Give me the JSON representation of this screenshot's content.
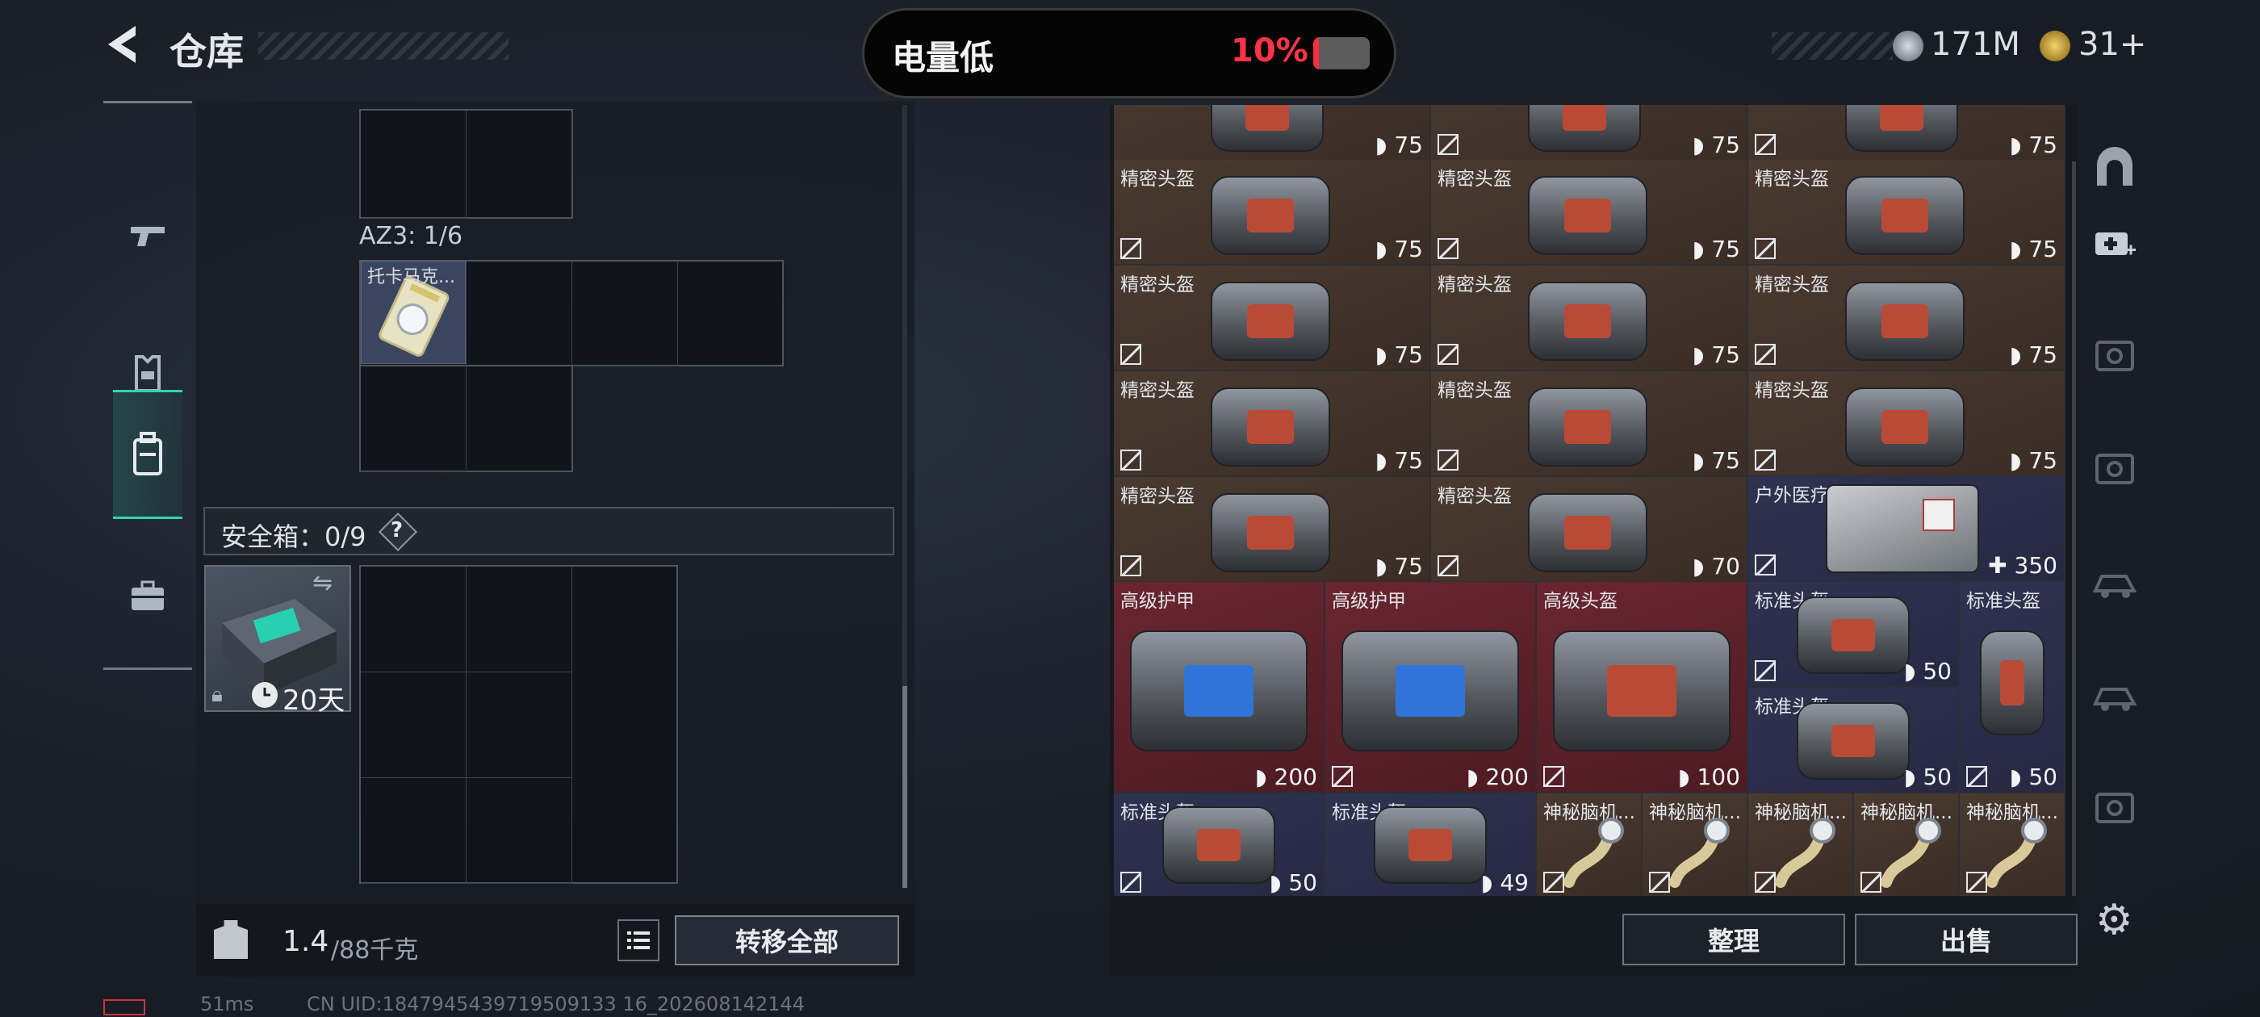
{
  "header": {
    "title": "仓库",
    "battery_text": "电量低",
    "battery_percent": "10%",
    "battery_level": 0.1,
    "currency_a": "171M",
    "currency_b": "31+"
  },
  "left_rail": {
    "items": [
      {
        "name": "weapon",
        "icon": "pistol-icon"
      },
      {
        "name": "armor",
        "icon": "vest-icon"
      },
      {
        "name": "backpack",
        "icon": "backpack-icon",
        "active": true
      },
      {
        "name": "case",
        "icon": "briefcase-icon"
      }
    ]
  },
  "container": {
    "az3_label": "AZ3: 1/6",
    "toka_label": "托卡马克..."
  },
  "safe_box": {
    "label": "安全箱：0/9",
    "help": "?",
    "days": "20天"
  },
  "weight": {
    "current": "1.4",
    "max": "/88千克"
  },
  "buttons": {
    "transfer_all": "转移全部",
    "sort": "整理",
    "sell": "出售"
  },
  "status": {
    "ping": "51ms",
    "uid": "CN UID:1847945439719509133 16_202608142144"
  },
  "inventory": {
    "top_row_values": [
      "75",
      "75",
      "75"
    ],
    "helmets": [
      {
        "name": "精密头盔",
        "value": "75"
      },
      {
        "name": "精密头盔",
        "value": "75"
      },
      {
        "name": "精密头盔",
        "value": "75"
      },
      {
        "name": "精密头盔",
        "value": "75"
      },
      {
        "name": "精密头盔",
        "value": "75"
      },
      {
        "name": "精密头盔",
        "value": "75"
      },
      {
        "name": "精密头盔",
        "value": "75"
      },
      {
        "name": "精密头盔",
        "value": "75"
      },
      {
        "name": "精密头盔",
        "value": "75"
      },
      {
        "name": "精密头盔",
        "value": "75"
      },
      {
        "name": "精密头盔",
        "value": "70"
      }
    ],
    "medkit": {
      "name": "户外医疗箱",
      "value": "350"
    },
    "large": [
      {
        "name": "高级护甲",
        "value": "200",
        "color": "blue"
      },
      {
        "name": "高级护甲",
        "value": "200",
        "color": "blue"
      },
      {
        "name": "高级头盔",
        "value": "100",
        "color": "red"
      }
    ],
    "standard": [
      {
        "name": "标准头盔",
        "value": "50"
      },
      {
        "name": "标准头盔",
        "value": "50"
      },
      {
        "name": "标准头盔",
        "value": "50"
      },
      {
        "name": "标准头盔",
        "value": "50"
      },
      {
        "name": "标准头盔",
        "value": "49"
      }
    ],
    "mystery": [
      {
        "name": "神秘脑机..."
      },
      {
        "name": "神秘脑机..."
      },
      {
        "name": "神秘脑机..."
      },
      {
        "name": "神秘脑机..."
      },
      {
        "name": "神秘脑机..."
      }
    ]
  },
  "colors": {
    "accent": "#2fd6b0",
    "battery_red": "#ff3347",
    "brown_tile": "#43352c",
    "red_tile": "#5e222b",
    "navy_tile": "#2b2f4a"
  }
}
